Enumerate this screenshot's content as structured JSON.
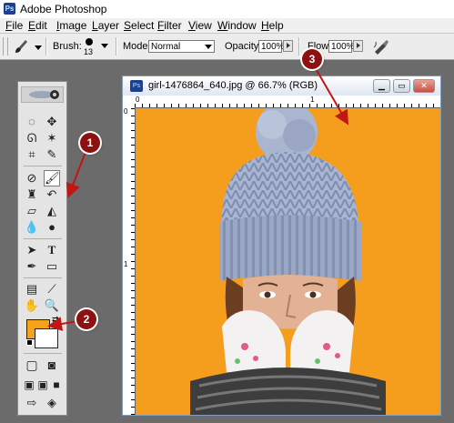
{
  "app": {
    "title": "Adobe Photoshop",
    "logo_text": "Ps"
  },
  "menu": {
    "items": [
      {
        "u": "F",
        "rest": "ile"
      },
      {
        "u": "E",
        "rest": "dit"
      },
      {
        "u": "I",
        "rest": "mage"
      },
      {
        "u": "L",
        "rest": "ayer"
      },
      {
        "u": "S",
        "rest": "elect"
      },
      {
        "u": "F",
        "rest": "ilter"
      },
      {
        "u": "V",
        "rest": "iew"
      },
      {
        "u": "W",
        "rest": "indow"
      },
      {
        "u": "H",
        "rest": "elp"
      }
    ]
  },
  "options": {
    "brush_label": "Brush:",
    "brush_size": "13",
    "mode_label": "Mode:",
    "mode_value": "Normal",
    "opacity_label": "Opacity:",
    "opacity_value": "100%",
    "flow_label": "Flow:",
    "flow_value": "100%"
  },
  "document": {
    "title": "girl-1476864_640.jpg @ 66.7% (RGB)",
    "ruler_top_labels": [
      "0",
      "1"
    ],
    "ruler_left_labels": [
      "0",
      "1"
    ]
  },
  "colors": {
    "foreground": "#f5a21c",
    "background": "#ffffff",
    "canvas_bg": "#f59e1d",
    "annotation": "#8d1111"
  },
  "annotations": [
    "1",
    "2",
    "3"
  ]
}
